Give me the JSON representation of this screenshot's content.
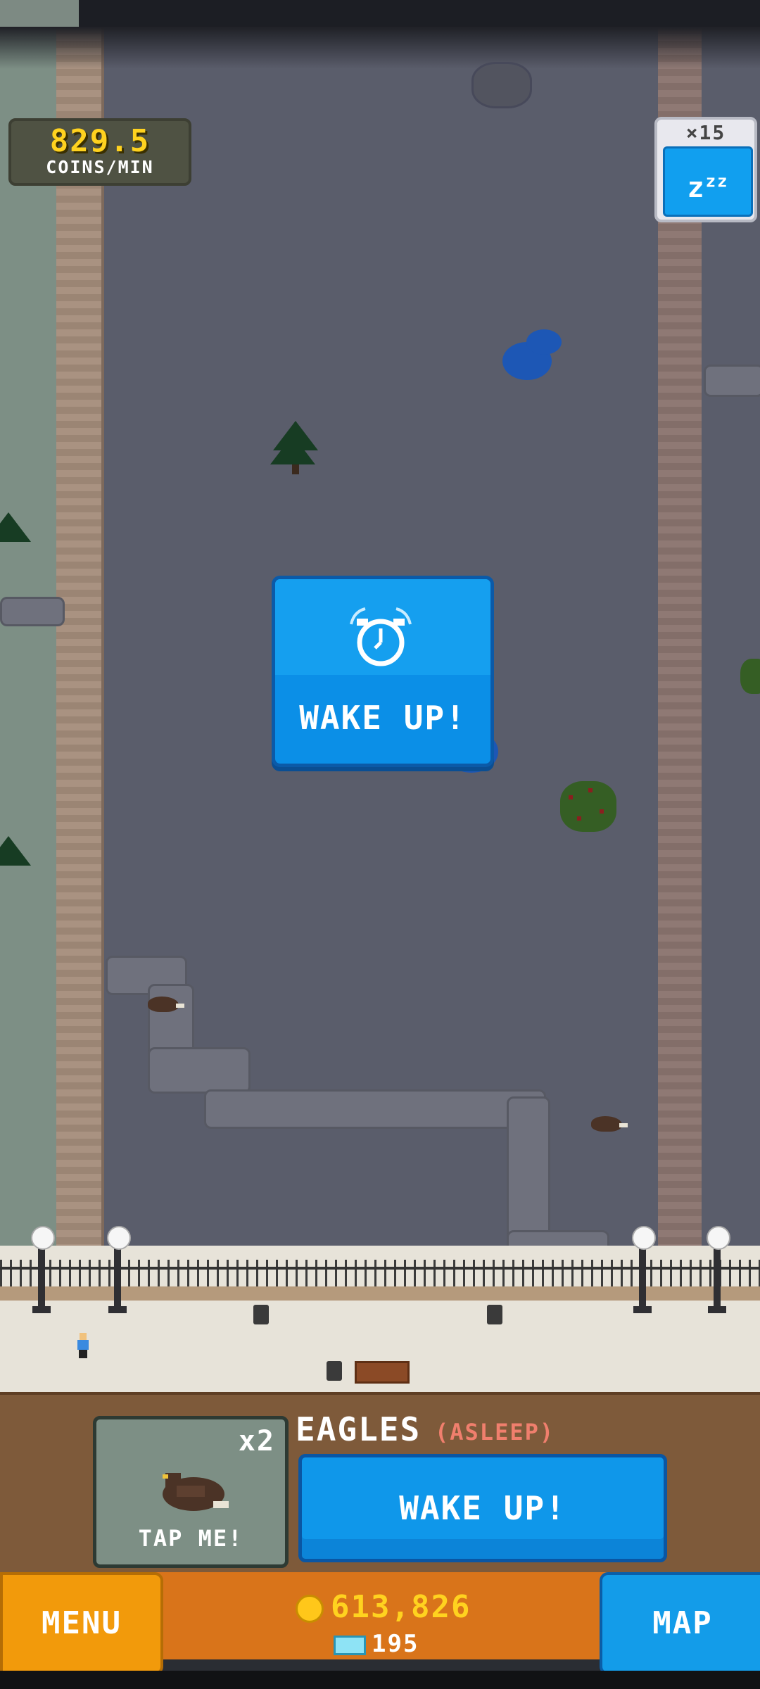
{
  "hud": {
    "coins_per_min_value": "829.5",
    "coins_per_min_unit": "COINS/MIN",
    "sleep_multiplier": "×15",
    "sleep_label": "zzz"
  },
  "world": {
    "center_button_label": "WAKE UP!"
  },
  "species_panel": {
    "card_multiplier": "x2",
    "card_label": "TAP ME!",
    "name": "EAGLES",
    "status": "(ASLEEP)",
    "wake_button_label": "WAKE UP!"
  },
  "bottom_bar": {
    "menu_label": "MENU",
    "map_label": "MAP",
    "coins": "613,826",
    "gems": "195"
  },
  "colors": {
    "accent_blue": "#119fef",
    "accent_orange": "#f29a0b",
    "coin_yellow": "#ffd21f"
  }
}
